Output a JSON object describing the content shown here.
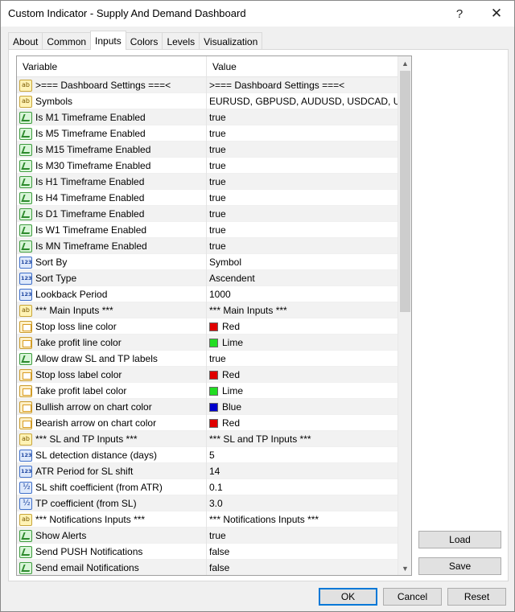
{
  "window": {
    "title": "Custom Indicator - Supply And Demand Dashboard",
    "help_label": "?",
    "close_label": "✕"
  },
  "tabs": [
    {
      "label": "About",
      "active": false
    },
    {
      "label": "Common",
      "active": false
    },
    {
      "label": "Inputs",
      "active": true
    },
    {
      "label": "Colors",
      "active": false
    },
    {
      "label": "Levels",
      "active": false
    },
    {
      "label": "Visualization",
      "active": false
    }
  ],
  "grid": {
    "headers": {
      "variable": "Variable",
      "value": "Value"
    },
    "rows": [
      {
        "icon": "ab",
        "variable": ">=== Dashboard Settings ===<",
        "value": ">=== Dashboard Settings ===<"
      },
      {
        "icon": "ab",
        "variable": "Symbols",
        "value": "EURUSD, GBPUSD, AUDUSD, USDCAD, U..."
      },
      {
        "icon": "bool",
        "variable": "Is M1 Timeframe Enabled",
        "value": "true"
      },
      {
        "icon": "bool",
        "variable": "Is M5 Timeframe Enabled",
        "value": "true"
      },
      {
        "icon": "bool",
        "variable": "Is M15 Timeframe Enabled",
        "value": "true"
      },
      {
        "icon": "bool",
        "variable": "Is M30 Timeframe Enabled",
        "value": "true"
      },
      {
        "icon": "bool",
        "variable": "Is H1 Timeframe Enabled",
        "value": "true"
      },
      {
        "icon": "bool",
        "variable": "Is H4 Timeframe Enabled",
        "value": "true"
      },
      {
        "icon": "bool",
        "variable": "Is D1 Timeframe Enabled",
        "value": "true"
      },
      {
        "icon": "bool",
        "variable": "Is W1 Timeframe Enabled",
        "value": "true"
      },
      {
        "icon": "bool",
        "variable": "Is MN Timeframe Enabled",
        "value": "true"
      },
      {
        "icon": "num",
        "variable": "Sort By",
        "value": "Symbol"
      },
      {
        "icon": "num",
        "variable": "Sort Type",
        "value": "Ascendent"
      },
      {
        "icon": "num",
        "variable": "Lookback Period",
        "value": "1000"
      },
      {
        "icon": "ab",
        "variable": "*** Main Inputs ***",
        "value": "*** Main Inputs ***"
      },
      {
        "icon": "color",
        "variable": "Stop loss line color",
        "value": "Red",
        "swatch": "#e00000"
      },
      {
        "icon": "color",
        "variable": "Take profit line color",
        "value": "Lime",
        "swatch": "#22dd22"
      },
      {
        "icon": "bool",
        "variable": "Allow draw SL and TP labels",
        "value": "true"
      },
      {
        "icon": "color",
        "variable": "Stop loss label color",
        "value": "Red",
        "swatch": "#e00000"
      },
      {
        "icon": "color",
        "variable": "Take profit label color",
        "value": "Lime",
        "swatch": "#22dd22"
      },
      {
        "icon": "color",
        "variable": "Bullish arrow on chart color",
        "value": "Blue",
        "swatch": "#0000cc"
      },
      {
        "icon": "color",
        "variable": "Bearish arrow on chart color",
        "value": "Red",
        "swatch": "#e00000"
      },
      {
        "icon": "ab",
        "variable": "*** SL and TP Inputs ***",
        "value": "*** SL and TP Inputs ***"
      },
      {
        "icon": "num",
        "variable": "SL detection distance (days)",
        "value": "5"
      },
      {
        "icon": "num",
        "variable": "ATR Period for SL shift",
        "value": "14"
      },
      {
        "icon": "dbl",
        "variable": "SL shift coefficient (from ATR)",
        "value": "0.1"
      },
      {
        "icon": "dbl",
        "variable": "TP coefficient (from SL)",
        "value": "3.0"
      },
      {
        "icon": "ab",
        "variable": "*** Notifications Inputs ***",
        "value": "*** Notifications Inputs ***"
      },
      {
        "icon": "bool",
        "variable": "Show Alerts",
        "value": "true"
      },
      {
        "icon": "bool",
        "variable": "Send PUSH Notifications",
        "value": "false"
      },
      {
        "icon": "bool",
        "variable": "Send email Notifications",
        "value": "false"
      }
    ]
  },
  "buttons": {
    "load": "Load",
    "save": "Save",
    "ok": "OK",
    "cancel": "Cancel",
    "reset": "Reset"
  },
  "colors": {
    "accent": "#0078d7",
    "red": "#e00000",
    "lime": "#22dd22",
    "blue": "#0000cc"
  }
}
